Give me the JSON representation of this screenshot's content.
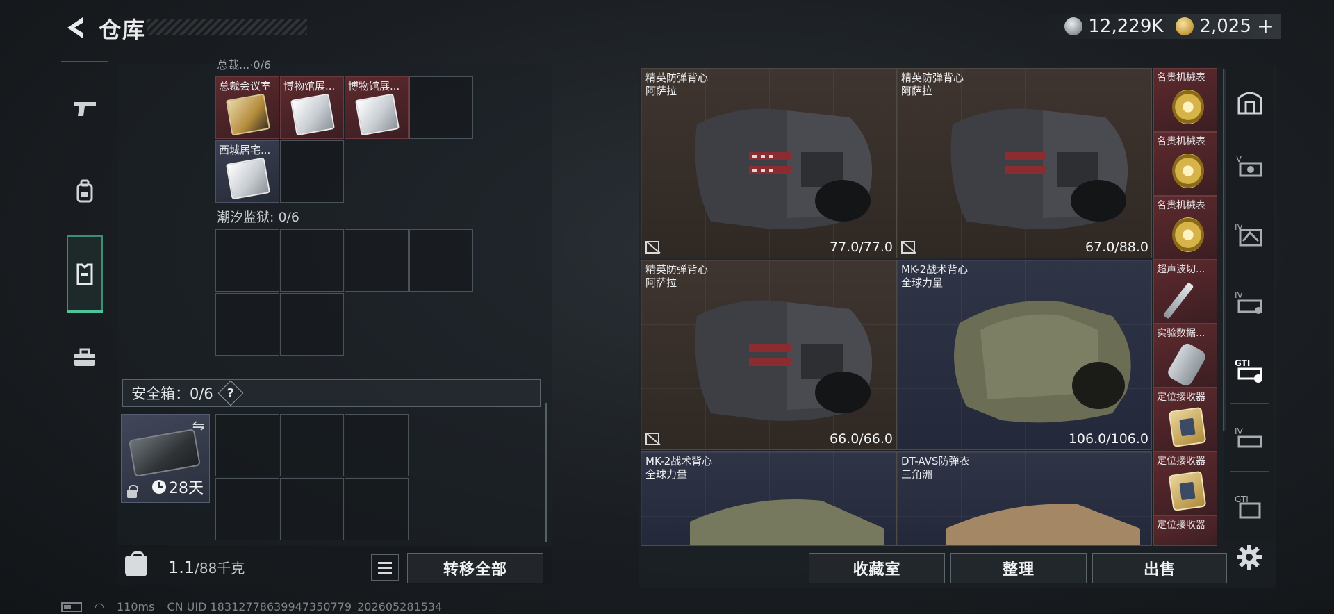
{
  "header": {
    "title": "仓库",
    "currencies": [
      {
        "icon": "silver-coin-icon",
        "value": "12,229K"
      },
      {
        "icon": "gold-coin-icon",
        "value": "2,025"
      }
    ],
    "add_label": "+"
  },
  "left_nav": [
    "pistol-icon",
    "backpack-icon",
    "vest-icon",
    "toolbox-icon"
  ],
  "storage": {
    "cut_heading": "总裁...·0/6",
    "row1": [
      "总裁会议室",
      "博物馆展...",
      "博物馆展..."
    ],
    "row2": [
      "西城居宅..."
    ],
    "section2": "潮汐监狱: 0/6"
  },
  "safebox": {
    "label": "安全箱：0/6",
    "help": "?",
    "days": "28天"
  },
  "capacity": {
    "value": "1.1",
    "unit": "/88千克"
  },
  "buttons": {
    "transfer_all": "转移全部",
    "collection": "收藏室",
    "organize": "整理",
    "sell": "出售"
  },
  "vests": [
    {
      "name": "精英防弹背心",
      "brand": "阿萨拉",
      "durability": "77.0/77.0"
    },
    {
      "name": "精英防弹背心",
      "brand": "阿萨拉",
      "durability": "67.0/88.0"
    },
    {
      "name": "精英防弹背心",
      "brand": "阿萨拉",
      "durability": "66.0/66.0"
    },
    {
      "name": "MK-2战术背心",
      "brand": "全球力量",
      "durability": "106.0/106.0"
    },
    {
      "name": "MK-2战术背心",
      "brand": "全球力量",
      "durability": ""
    },
    {
      "name": "DT-AVS防弹衣",
      "brand": "三角洲",
      "durability": ""
    }
  ],
  "side_items": [
    "名贵机械表",
    "名贵机械表",
    "名贵机械表",
    "超声波切...",
    "实验数据...",
    "定位接收器",
    "定位接收器",
    "定位接收器"
  ],
  "right_nav": [
    "vault-icon",
    "v-tier-icon",
    "iv-tier-icon",
    "iv-tier-icon-2",
    "gti-icon",
    "iv-tier-icon-3",
    "g-tier-icon"
  ],
  "status": {
    "ping": "110ms",
    "uid": "CN UID 18312778639947350779_202605281534"
  }
}
